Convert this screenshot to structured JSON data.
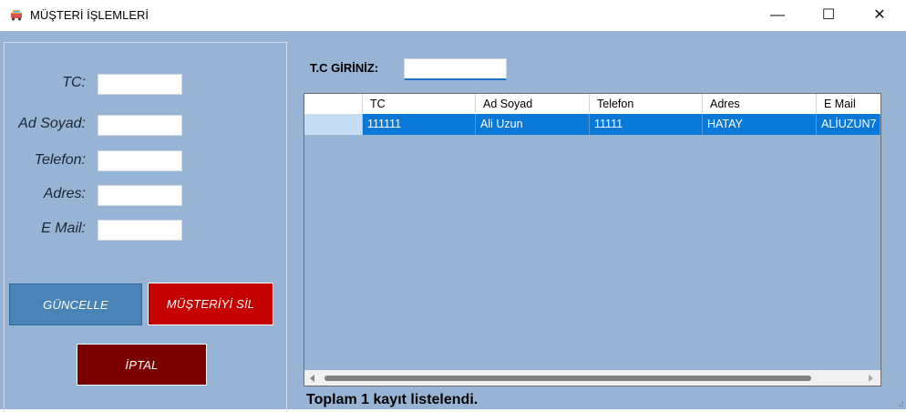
{
  "window": {
    "title": "MÜŞTERİ İŞLEMLERİ",
    "icon": "car-icon",
    "controls": {
      "minimize": "—",
      "maximize": "☐",
      "close": "✕"
    }
  },
  "form": {
    "labels": {
      "tc": "TC:",
      "ad_soyad": "Ad Soyad:",
      "telefon": "Telefon:",
      "adres": "Adres:",
      "email": "E Mail:"
    },
    "values": {
      "tc": "",
      "ad_soyad": "",
      "telefon": "",
      "adres": "",
      "email": ""
    },
    "buttons": {
      "update": "GÜNCELLE",
      "delete": "MÜŞTERİYİ SİL",
      "cancel": "İPTAL"
    }
  },
  "search": {
    "label": "T.C GİRİNİZ:",
    "value": ""
  },
  "grid": {
    "columns": [
      "TC",
      "Ad Soyad",
      "Telefon",
      "Adres",
      "E Mail"
    ],
    "rows": [
      [
        "111111",
        "Ali Uzun",
        "11111",
        "HATAY",
        "ALİUZUN7"
      ]
    ]
  },
  "status": "Toplam 1 kayıt listelendi.",
  "colors": {
    "background": "#98b4d4",
    "update_button": "#4a83b5",
    "delete_button": "#c40000",
    "cancel_button": "#7a0000",
    "row_selected": "#0a78d7"
  }
}
